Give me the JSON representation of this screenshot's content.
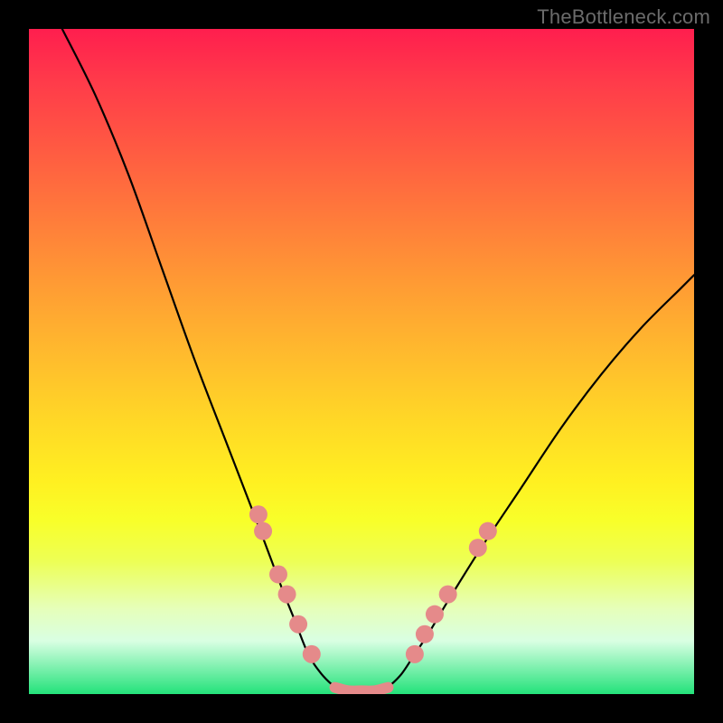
{
  "watermark": "TheBottleneck.com",
  "chart_data": {
    "type": "line",
    "title": "",
    "xlabel": "",
    "ylabel": "",
    "xlim": [
      0,
      100
    ],
    "ylim": [
      0,
      100
    ],
    "grid": false,
    "legend": false,
    "background": "rainbow-gradient-vertical",
    "series": [
      {
        "name": "left-curve",
        "stroke": "#000000",
        "x": [
          5,
          10,
          15,
          20,
          25,
          30,
          35,
          38,
          40,
          42,
          44,
          46
        ],
        "values": [
          100,
          90,
          78,
          64,
          50,
          37,
          24,
          16,
          11,
          6,
          3,
          1
        ]
      },
      {
        "name": "right-curve",
        "stroke": "#000000",
        "x": [
          54,
          56,
          58,
          60,
          63,
          68,
          74,
          80,
          86,
          92,
          98,
          100
        ],
        "values": [
          1,
          3,
          6,
          9,
          14,
          22,
          31,
          40,
          48,
          55,
          61,
          63
        ]
      },
      {
        "name": "valley-floor",
        "stroke": "#e58a8a",
        "x": [
          46,
          48,
          50,
          52,
          54
        ],
        "values": [
          1,
          0.5,
          0.5,
          0.5,
          1
        ]
      }
    ],
    "markers": [
      {
        "series": "left-side-dots",
        "x": 34.5,
        "y": 27,
        "color": "#e58a8a"
      },
      {
        "series": "left-side-dots",
        "x": 35.2,
        "y": 24.5,
        "color": "#e58a8a"
      },
      {
        "series": "left-side-dots",
        "x": 37.5,
        "y": 18,
        "color": "#e58a8a"
      },
      {
        "series": "left-side-dots",
        "x": 38.8,
        "y": 15,
        "color": "#e58a8a"
      },
      {
        "series": "left-side-dots",
        "x": 40.5,
        "y": 10.5,
        "color": "#e58a8a"
      },
      {
        "series": "left-side-dots",
        "x": 42.5,
        "y": 6,
        "color": "#e58a8a"
      },
      {
        "series": "right-side-dots",
        "x": 58,
        "y": 6,
        "color": "#e58a8a"
      },
      {
        "series": "right-side-dots",
        "x": 59.5,
        "y": 9,
        "color": "#e58a8a"
      },
      {
        "series": "right-side-dots",
        "x": 61,
        "y": 12,
        "color": "#e58a8a"
      },
      {
        "series": "right-side-dots",
        "x": 63,
        "y": 15,
        "color": "#e58a8a"
      },
      {
        "series": "right-side-dots",
        "x": 67.5,
        "y": 22,
        "color": "#e58a8a"
      },
      {
        "series": "right-side-dots",
        "x": 69,
        "y": 24.5,
        "color": "#e58a8a"
      }
    ]
  }
}
